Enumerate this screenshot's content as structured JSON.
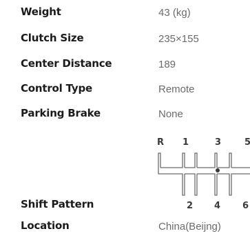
{
  "specs": [
    {
      "label": "Weight",
      "value": "43 (kg)"
    },
    {
      "label": "Clutch Size",
      "value": "235×155"
    },
    {
      "label": "Center Distance",
      "value": "189"
    },
    {
      "label": "Control Type",
      "value": "Remote"
    },
    {
      "label": "Parking Brake",
      "value": "None"
    },
    {
      "label": "Shift Pattern",
      "value": ""
    },
    {
      "label": "Location",
      "value": "China(Beijng)"
    }
  ],
  "shift_pattern": {
    "top_gears": [
      "R",
      "1",
      "3",
      "5"
    ],
    "bottom_gears": [
      "2",
      "4",
      "6"
    ],
    "neutral_marker": "dot"
  }
}
